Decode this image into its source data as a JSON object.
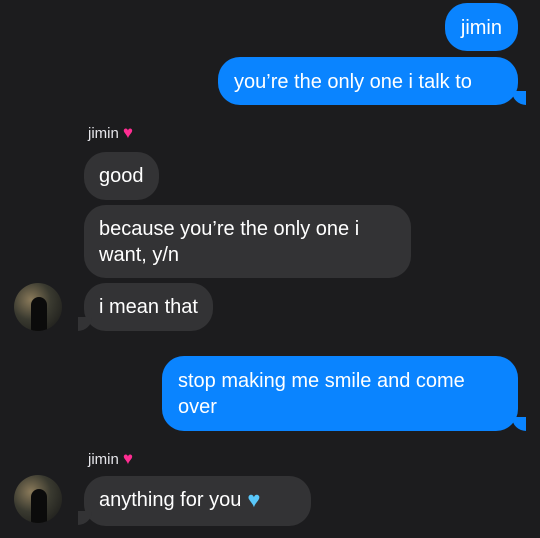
{
  "conversation": {
    "outgoing_1": "jimin",
    "outgoing_2": "you’re the only one i talk to",
    "sender_1": "jimin",
    "incoming_1": "good",
    "incoming_2": "because you’re the only one i want, y/n",
    "incoming_3": "i mean that",
    "outgoing_3": "stop making me smile and come over",
    "sender_2": "jimin",
    "incoming_4": "anything for you"
  },
  "icons": {
    "sender_heart": "pink-heart-icon",
    "message_heart": "light-blue-heart-icon",
    "avatar": "contact-avatar"
  },
  "colors": {
    "background": "#1c1c1e",
    "outgoing_bubble": "#0a84ff",
    "incoming_bubble": "#333335",
    "pink_heart": "#ff2d92",
    "blue_heart": "#5ac8fa"
  }
}
